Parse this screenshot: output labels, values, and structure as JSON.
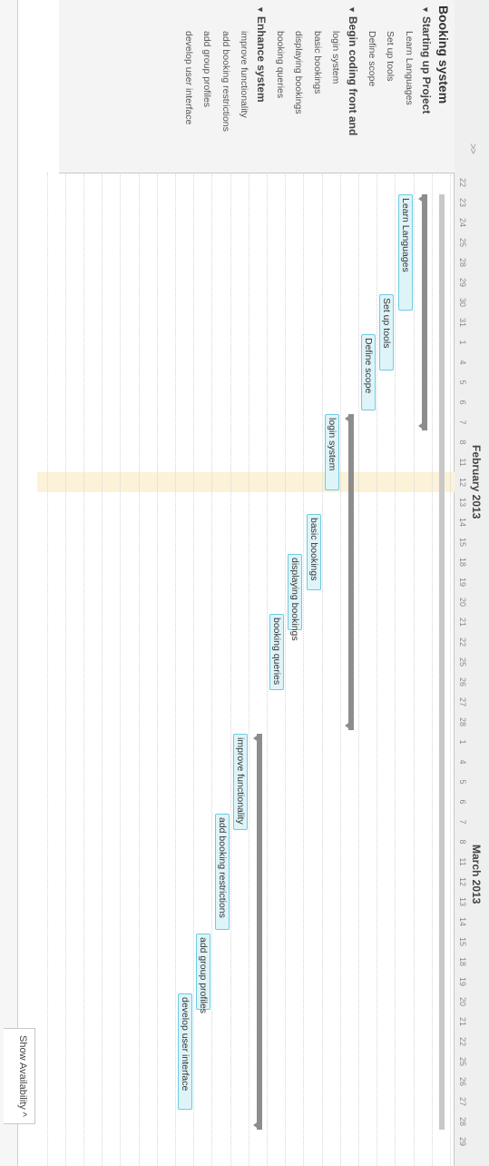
{
  "header": {
    "collapse_label": ">>"
  },
  "timeline": {
    "months": [
      "February 2013",
      "March 2013"
    ],
    "days": [
      "22",
      "23",
      "24",
      "25",
      "28",
      "29",
      "30",
      "31",
      "1",
      "4",
      "5",
      "6",
      "7",
      "8",
      "11",
      "12",
      "13",
      "14",
      "15",
      "18",
      "19",
      "20",
      "21",
      "22",
      "25",
      "26",
      "27",
      "28",
      "1",
      "4",
      "5",
      "6",
      "7",
      "8",
      "11",
      "12",
      "13",
      "14",
      "15",
      "18",
      "19",
      "20",
      "21",
      "22",
      "25",
      "26",
      "27",
      "28",
      "29"
    ],
    "highlight_day_index": 15
  },
  "tree": {
    "project": "Booking system",
    "groups": [
      {
        "label": "Starting up Project",
        "tasks": [
          "Learn Languages",
          "Set up tools",
          "Define scope"
        ]
      },
      {
        "label": "Begin coding front and",
        "tasks": [
          "login system",
          "basic bookings",
          "displaying bookings",
          "booking queries"
        ]
      },
      {
        "label": "Enhance system",
        "tasks": [
          "improve functionality",
          "add booking restrictions",
          "add group profiles",
          "develop user interface"
        ]
      }
    ]
  },
  "gantt": {
    "project_span": {
      "start_index": 1,
      "end_index": 47
    },
    "groups": [
      {
        "start_index": 1,
        "end_index": 12
      },
      {
        "start_index": 12,
        "end_index": 27
      },
      {
        "start_index": 28,
        "end_index": 47
      }
    ],
    "tasks": [
      {
        "label": "Learn Languages",
        "start_index": 1,
        "end_index": 7
      },
      {
        "label": "Set up tools",
        "start_index": 6,
        "end_index": 10
      },
      {
        "label": "Define scope",
        "start_index": 8,
        "end_index": 12
      },
      {
        "label": "login system",
        "start_index": 12,
        "end_index": 16
      },
      {
        "label": "basic bookings",
        "start_index": 17,
        "end_index": 21
      },
      {
        "label": "displaying bookings",
        "start_index": 19,
        "end_index": 23
      },
      {
        "label": "booking queries",
        "start_index": 22,
        "end_index": 26
      },
      {
        "label": "improve functionality",
        "start_index": 28,
        "end_index": 33
      },
      {
        "label": "add booking restrictions",
        "start_index": 32,
        "end_index": 38
      },
      {
        "label": "add group profiles",
        "start_index": 38,
        "end_index": 42
      },
      {
        "label": "develop user interface",
        "start_index": 41,
        "end_index": 47
      }
    ]
  },
  "footer": {
    "availability_label": "Show Availability ^"
  }
}
